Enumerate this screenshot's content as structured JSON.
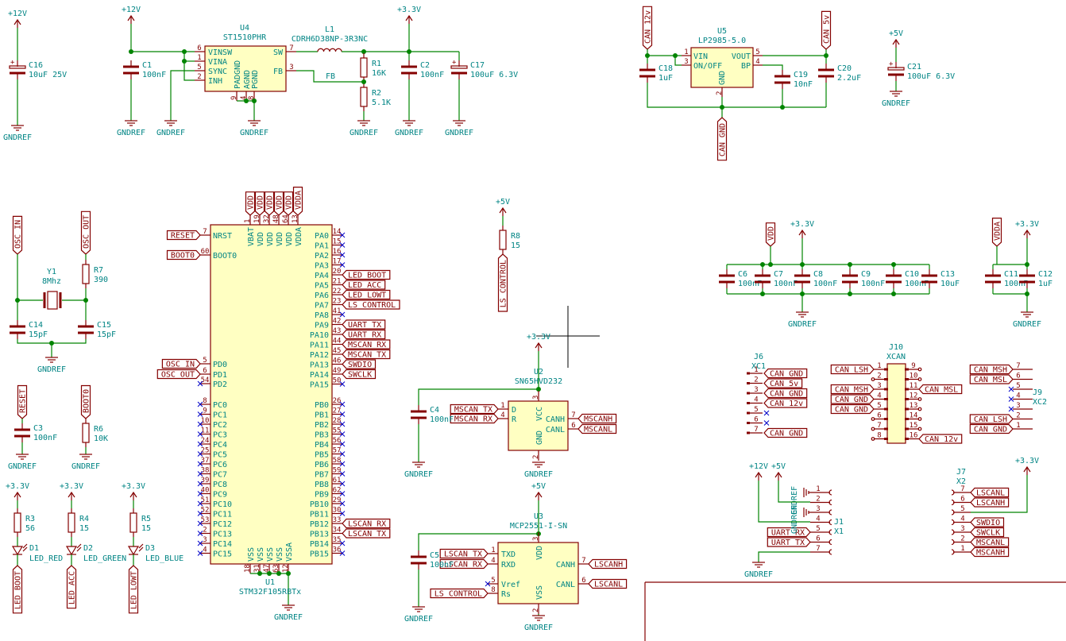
{
  "power": {
    "p12": "+12V",
    "p33": "+3.3V",
    "p5": "+5V",
    "gnd": "GNDREF"
  },
  "colors": {
    "wire": "#008400",
    "component": "#840000",
    "text": "#008484",
    "body_fill": "#ffffc2",
    "no_connect": "#0000c8"
  },
  "components": {
    "C16": {
      "ref": "C16",
      "value": "10uF 25V"
    },
    "C1": {
      "ref": "C1",
      "value": "100nF"
    },
    "U4": {
      "ref": "U4",
      "value": "ST1510PHR",
      "pins": {
        "vinsw": "VINSW",
        "vina": "VINA",
        "sync": "SYNC",
        "inh": "INH",
        "sw": "SW",
        "fb": "FB",
        "padgnd": "PADGND",
        "agnd": "AGND",
        "pgnd": "PGND",
        "n6": "6",
        "n1": "1",
        "n5": "5",
        "n2": "2",
        "n7": "7",
        "n3": "3",
        "n9": "9",
        "n4": "4",
        "n8": "8"
      }
    },
    "L1": {
      "ref": "L1",
      "value": "CDRH6D38NP-3R3NC"
    },
    "R1": {
      "ref": "R1",
      "value": "16K"
    },
    "R2": {
      "ref": "R2",
      "value": "5.1K"
    },
    "C2": {
      "ref": "C2",
      "value": "100nF"
    },
    "C17": {
      "ref": "C17",
      "value": "100uF 6.3V"
    },
    "U5": {
      "ref": "U5",
      "value": "LP2985-5.0",
      "pins": {
        "vin": "VIN",
        "onoff": "ON/OFF",
        "vout": "VOUT",
        "bp": "BP",
        "gnd": "GND",
        "n1": "1",
        "n3": "3",
        "n5": "5",
        "n4": "4",
        "n2": "2"
      }
    },
    "C18": {
      "ref": "C18",
      "value": "1uF"
    },
    "C19": {
      "ref": "C19",
      "value": "10nF"
    },
    "C20": {
      "ref": "C20",
      "value": "2.2uF"
    },
    "C21": {
      "ref": "C21",
      "value": "100uF 6.3V"
    },
    "Y1": {
      "ref": "Y1",
      "value": "8Mhz"
    },
    "R7": {
      "ref": "R7",
      "value": "390"
    },
    "C14": {
      "ref": "C14",
      "value": "15pF"
    },
    "C15": {
      "ref": "C15",
      "value": "15pF"
    },
    "C3": {
      "ref": "C3",
      "value": "100nF"
    },
    "R6": {
      "ref": "R6",
      "value": "10K"
    },
    "R3": {
      "ref": "R3",
      "value": "56"
    },
    "R4": {
      "ref": "R4",
      "value": "15"
    },
    "R5": {
      "ref": "R5",
      "value": "15"
    },
    "D1": {
      "ref": "D1",
      "value": "LED_RED"
    },
    "D2": {
      "ref": "D2",
      "value": "LED_GREEN"
    },
    "D3": {
      "ref": "D3",
      "value": "LED_BLUE"
    },
    "R8": {
      "ref": "R8",
      "value": "15"
    },
    "U2": {
      "ref": "U2",
      "value": "SN65HVD232",
      "pins": {
        "d": "D",
        "r": "R",
        "vcc": "VCC",
        "gnd": "GND",
        "canh": "CANH",
        "canl": "CANL",
        "n1": "1",
        "n4": "4",
        "n3": "3",
        "n2": "2",
        "n7": "7",
        "n6": "6"
      }
    },
    "C4": {
      "ref": "C4",
      "value": "100nF"
    },
    "U3": {
      "ref": "U3",
      "value": "MCP2551-I-SN",
      "pins": {
        "txd": "TXD",
        "rxd": "RXD",
        "vref": "Vref",
        "rs": "Rs",
        "vdd": "VDD",
        "vss": "VSS",
        "canh": "CANH",
        "canl": "CANL",
        "n1": "1",
        "n4": "4",
        "n5": "5",
        "n8": "8",
        "n3": "3",
        "n2": "2",
        "n7": "7",
        "n6": "6"
      }
    },
    "C5": {
      "ref": "C5",
      "value": "100nF"
    },
    "C6": {
      "ref": "C6",
      "value": "100nF"
    },
    "C7": {
      "ref": "C7",
      "value": "100nF"
    },
    "C8": {
      "ref": "C8",
      "value": "100nF"
    },
    "C9": {
      "ref": "C9",
      "value": "100nF"
    },
    "C10": {
      "ref": "C10",
      "value": "100nF"
    },
    "C13": {
      "ref": "C13",
      "value": "10uF"
    },
    "C11": {
      "ref": "C11",
      "value": "100nF"
    },
    "C12": {
      "ref": "C12",
      "value": "1uF"
    },
    "J6": {
      "ref": "J6",
      "value": "XC1"
    },
    "J10": {
      "ref": "J10",
      "value": "XCAN"
    },
    "J9": {
      "ref": "J9",
      "value": "XC2"
    },
    "J1": {
      "ref": "J1",
      "value": "X1"
    },
    "J7": {
      "ref": "J7",
      "value": "X2"
    }
  },
  "nets": {
    "fb": "FB",
    "can_12v": "CAN_12v",
    "can_5v": "CAN_5v",
    "can_gnd": "CAN_GND",
    "osc_in": "OSC_IN",
    "osc_out": "OSC_OUT",
    "reset": "RESET",
    "boot0": "BOOT0",
    "led_boot": "LED_BOOT",
    "led_acc": "LED_ACC",
    "led_lowt": "LED_LOWT",
    "ls_control": "LS_CONTROL",
    "mscan_tx": "MSCAN_TX",
    "mscan_rx": "MSCAN_RX",
    "mscanh": "MSCANH",
    "mscanl": "MSCANL",
    "lscan_tx": "LSCAN_TX",
    "lscan_rx": "LSCAN_RX",
    "lscanh": "LSCANH",
    "lscanl": "LSCANL",
    "vdd": "VDD",
    "vdda": "VDDA",
    "can_lsh": "CAN_LSH",
    "can_msh": "CAN_MSH",
    "can_msl": "CAN_MSL",
    "uart_rx": "UART_RX",
    "uart_tx": "UART_TX",
    "swdio": "SWDIO",
    "swclk": "SWCLK"
  },
  "mcu": {
    "ref": "U1",
    "value": "STM32F105RBTx",
    "top_pins": [
      {
        "name": "VBAT",
        "num": "1",
        "net": "VDD"
      },
      {
        "name": "VDD",
        "num": "19",
        "net": "VDD"
      },
      {
        "name": "VDD",
        "num": "32",
        "net": "VDD"
      },
      {
        "name": "VDD",
        "num": "48",
        "net": "VDD"
      },
      {
        "name": "VDD",
        "num": "64",
        "net": "VDD"
      },
      {
        "name": "VDDA",
        "num": "13",
        "net": "VDDA"
      }
    ],
    "left_pins": [
      {
        "name": "NRST",
        "num": "7",
        "net": "RESET"
      },
      {
        "name": "BOOT0",
        "num": "60",
        "net": "BOOT0"
      },
      {
        "name": "PD0",
        "num": "5",
        "net": "OSC_IN"
      },
      {
        "name": "PD1",
        "num": "6",
        "net": "OSC_OUT"
      },
      {
        "name": "PD2",
        "num": "54"
      },
      {
        "name": "PC0",
        "num": "8"
      },
      {
        "name": "PC1",
        "num": "9"
      },
      {
        "name": "PC2",
        "num": "10"
      },
      {
        "name": "PC3",
        "num": "11"
      },
      {
        "name": "PC4",
        "num": "24"
      },
      {
        "name": "PC5",
        "num": "25"
      },
      {
        "name": "PC6",
        "num": "37"
      },
      {
        "name": "PC7",
        "num": "38"
      },
      {
        "name": "PC8",
        "num": "39"
      },
      {
        "name": "PC9",
        "num": "40"
      },
      {
        "name": "PC10",
        "num": "51"
      },
      {
        "name": "PC11",
        "num": "52"
      },
      {
        "name": "PC12",
        "num": "53"
      },
      {
        "name": "PC13",
        "num": "2"
      },
      {
        "name": "PC14",
        "num": "3"
      },
      {
        "name": "PC15",
        "num": "4"
      }
    ],
    "right_pins": [
      {
        "name": "PA0",
        "num": "14"
      },
      {
        "name": "PA1",
        "num": "15"
      },
      {
        "name": "PA2",
        "num": "16"
      },
      {
        "name": "PA3",
        "num": "17"
      },
      {
        "name": "PA4",
        "num": "20",
        "net": "LED_BOOT"
      },
      {
        "name": "PA5",
        "num": "21",
        "net": "LED_ACC"
      },
      {
        "name": "PA6",
        "num": "22",
        "net": "LED_LOWT"
      },
      {
        "name": "PA7",
        "num": "23",
        "net": "LS_CONTROL"
      },
      {
        "name": "PA8",
        "num": "41"
      },
      {
        "name": "PA9",
        "num": "42",
        "net": "UART_TX"
      },
      {
        "name": "PA10",
        "num": "43",
        "net": "UART_RX"
      },
      {
        "name": "PA11",
        "num": "44",
        "net": "MSCAN_RX"
      },
      {
        "name": "PA12",
        "num": "45",
        "net": "MSCAN_TX"
      },
      {
        "name": "PA13",
        "num": "46",
        "net": "SWDIO"
      },
      {
        "name": "PA14",
        "num": "49",
        "net": "SWCLK"
      },
      {
        "name": "PA15",
        "num": "50"
      },
      {
        "name": "PB0",
        "num": "26"
      },
      {
        "name": "PB1",
        "num": "27"
      },
      {
        "name": "PB2",
        "num": "28"
      },
      {
        "name": "PB3",
        "num": "55"
      },
      {
        "name": "PB4",
        "num": "56"
      },
      {
        "name": "PB5",
        "num": "57"
      },
      {
        "name": "PB6",
        "num": "58"
      },
      {
        "name": "PB7",
        "num": "59"
      },
      {
        "name": "PB8",
        "num": "61"
      },
      {
        "name": "PB9",
        "num": "62"
      },
      {
        "name": "PB10",
        "num": "29"
      },
      {
        "name": "PB11",
        "num": "30"
      },
      {
        "name": "PB12",
        "num": "33",
        "net": "LSCAN_RX"
      },
      {
        "name": "PB13",
        "num": "34",
        "net": "LSCAN_TX"
      },
      {
        "name": "PB14",
        "num": "35"
      },
      {
        "name": "PB15",
        "num": "36"
      }
    ],
    "bottom_pins": [
      {
        "name": "VSS",
        "num": "18"
      },
      {
        "name": "VSS",
        "num": "31"
      },
      {
        "name": "VSS",
        "num": "47"
      },
      {
        "name": "VSS",
        "num": "63"
      },
      {
        "name": "VSSA",
        "num": "12"
      }
    ]
  },
  "connectors": {
    "J6": {
      "pins": [
        {
          "num": "1",
          "net": "CAN_GND"
        },
        {
          "num": "2",
          "net": "CAN_5v"
        },
        {
          "num": "3",
          "net": "CAN_GND"
        },
        {
          "num": "4",
          "net": "CAN_12v"
        },
        {
          "num": "5"
        },
        {
          "num": "6"
        },
        {
          "num": "7",
          "net": "CAN_GND"
        }
      ]
    },
    "J10": {
      "left": [
        {
          "num": "1",
          "net": "CAN_LSH"
        },
        {
          "num": "2"
        },
        {
          "num": "3",
          "net": "CAN_MSH"
        },
        {
          "num": "4",
          "net": "CAN_GND"
        },
        {
          "num": "5",
          "net": "CAN_GND"
        },
        {
          "num": "6"
        },
        {
          "num": "7"
        },
        {
          "num": "8"
        }
      ],
      "right": [
        {
          "num": "9"
        },
        {
          "num": "10"
        },
        {
          "num": "11",
          "net": "CAN_MSL"
        },
        {
          "num": "12"
        },
        {
          "num": "13"
        },
        {
          "num": "14"
        },
        {
          "num": "15"
        },
        {
          "num": "16",
          "net": "CAN_12v"
        }
      ]
    },
    "J9": {
      "pins": [
        {
          "num": "7",
          "net": "CAN_MSH"
        },
        {
          "num": "6",
          "net": "CAN_MSL"
        },
        {
          "num": "5"
        },
        {
          "num": "4"
        },
        {
          "num": "3"
        },
        {
          "num": "2",
          "net": "CAN_LSH"
        },
        {
          "num": "1",
          "net": "CAN_GND"
        }
      ]
    },
    "J1": {
      "pins": [
        {
          "num": "1"
        },
        {
          "num": "2"
        },
        {
          "num": "3"
        },
        {
          "num": "4"
        },
        {
          "num": "5",
          "net": "UART_RX"
        },
        {
          "num": "6",
          "net": "UART_TX"
        },
        {
          "num": "7"
        }
      ]
    },
    "J7": {
      "pins": [
        {
          "num": "7",
          "net": "LSCANL"
        },
        {
          "num": "6",
          "net": "LSCANH"
        },
        {
          "num": "5"
        },
        {
          "num": "4",
          "net": "SWDIO"
        },
        {
          "num": "3",
          "net": "SWCLK"
        },
        {
          "num": "2",
          "net": "MSCANL"
        },
        {
          "num": "1",
          "net": "MSCANH"
        }
      ]
    }
  }
}
